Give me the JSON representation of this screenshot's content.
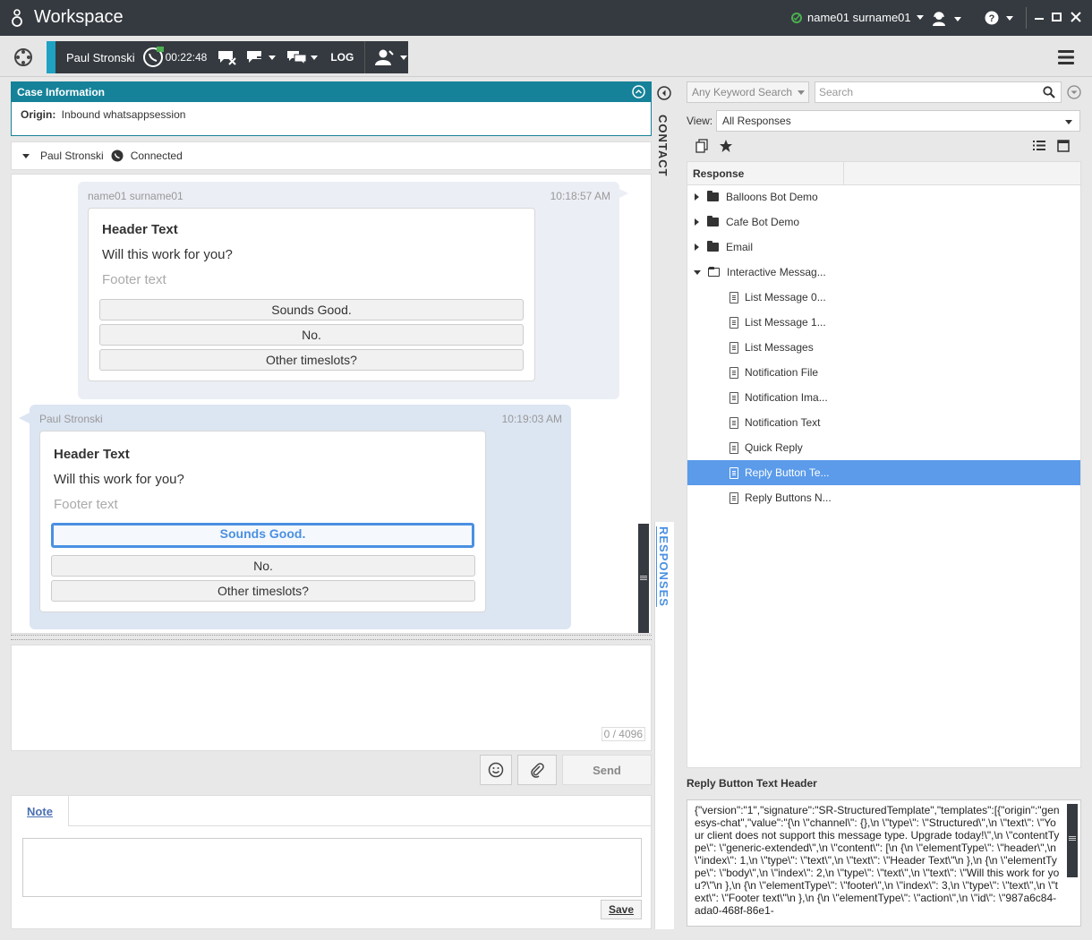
{
  "app": {
    "title": "Workspace"
  },
  "titlebar": {
    "user_name": "name01 surname01",
    "status_color": "#4caf50"
  },
  "interaction": {
    "contact_name": "Paul Stronski",
    "timer": "00:22:48",
    "log_label": "LOG"
  },
  "case_info": {
    "title": "Case Information",
    "origin_label": "Origin:",
    "origin_value": "Inbound whatsappsession"
  },
  "side_tabs": {
    "contact": "CONTACT",
    "responses": "RESPONSES"
  },
  "chat_header": {
    "name": "Paul Stronski",
    "status": "Connected"
  },
  "messages": [
    {
      "from": "name01 surname01",
      "time": "10:18:57 AM",
      "header": "Header Text",
      "body": "Will this work for you?",
      "footer": "Footer text",
      "buttons": [
        "Sounds Good.",
        "No.",
        "Other timeslots?"
      ]
    },
    {
      "from": "Paul Stronski",
      "time": "10:19:03 AM",
      "header": "Header Text",
      "body": "Will this work for you?",
      "footer": "Footer text",
      "buttons": [
        "Sounds Good.",
        "No.",
        "Other timeslots?"
      ],
      "selected": "Sounds Good."
    }
  ],
  "compose": {
    "counter": "0 / 4096",
    "send_label": "Send"
  },
  "note": {
    "tab_label": "Note",
    "save_label": "Save"
  },
  "responses": {
    "keyword_select": "Any Keyword Search",
    "search_placeholder": "Search",
    "view_label": "View:",
    "view_value": "All Responses",
    "column_header": "Response",
    "tree": [
      {
        "label": "Balloons Bot Demo",
        "kind": "folder",
        "expanded": false
      },
      {
        "label": "Cafe Bot Demo",
        "kind": "folder",
        "expanded": false
      },
      {
        "label": "Email",
        "kind": "folder",
        "expanded": false
      },
      {
        "label": "Interactive Messag...",
        "kind": "folder",
        "expanded": true
      },
      {
        "label": "List Message 0...",
        "kind": "doc"
      },
      {
        "label": "List Message 1...",
        "kind": "doc"
      },
      {
        "label": "List Messages",
        "kind": "doc"
      },
      {
        "label": "Notification File",
        "kind": "doc"
      },
      {
        "label": "Notification Ima...",
        "kind": "doc"
      },
      {
        "label": "Notification Text",
        "kind": "doc"
      },
      {
        "label": "Quick Reply",
        "kind": "doc"
      },
      {
        "label": "Reply Button Te...",
        "kind": "doc",
        "selected": true
      },
      {
        "label": "Reply Buttons N...",
        "kind": "doc"
      }
    ],
    "preview_title": "Reply Button Text Header",
    "preview_text": "{\"version\":\"1\",\"signature\":\"SR-StructuredTemplate\",\"templates\":[{\"origin\":\"genesys-chat\",\"value\":\"{\\n \\\"channel\\\": {},\\n \\\"type\\\": \\\"Structured\\\",\\n \\\"text\\\": \\\"Your client does not support this message type. Upgrade today!\\\",\\n \\\"contentType\\\": \\\"generic-extended\\\",\\n \\\"content\\\": [\\n {\\n \\\"elementType\\\": \\\"header\\\",\\n \\\"index\\\": 1,\\n \\\"type\\\": \\\"text\\\",\\n \\\"text\\\": \\\"Header Text\\\"\\n },\\n {\\n \\\"elementType\\\": \\\"body\\\",\\n \\\"index\\\": 2,\\n \\\"type\\\": \\\"text\\\",\\n \\\"text\\\": \\\"Will this work for you?\\\"\\n },\\n {\\n \\\"elementType\\\": \\\"footer\\\",\\n \\\"index\\\": 3,\\n \\\"type\\\": \\\"text\\\",\\n \\\"text\\\": \\\"Footer text\\\"\\n },\\n {\\n \\\"elementType\\\": \\\"action\\\",\\n \\\"id\\\": \\\"987a6c84-ada0-468f-86e1-"
  },
  "colors": {
    "dark": "#353a40",
    "accent": "#158299",
    "selection": "#5b9bea"
  }
}
